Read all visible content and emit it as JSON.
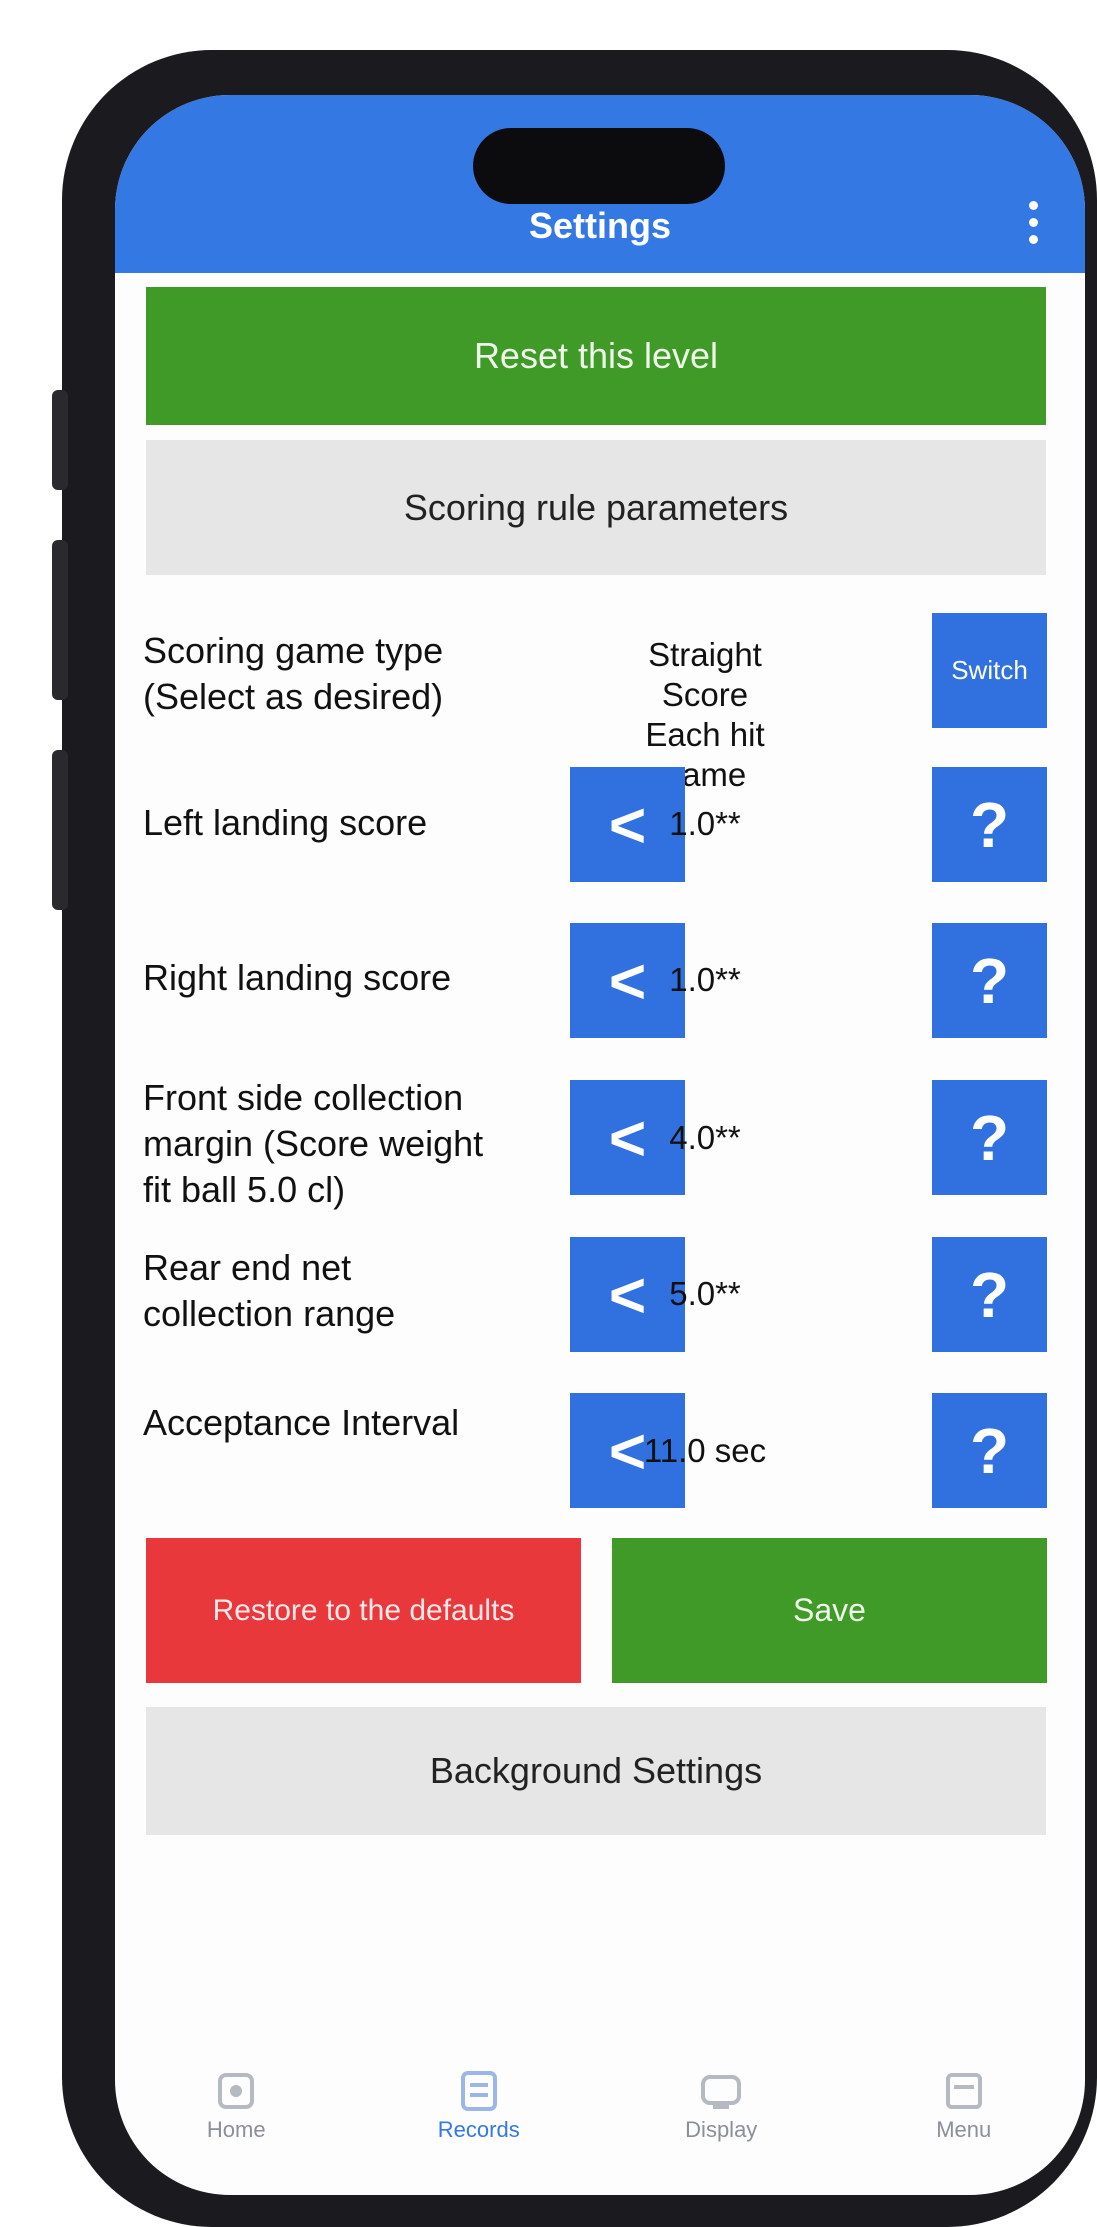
{
  "status": {
    "time": "",
    "indicators": ""
  },
  "appbar": {
    "title": "Settings"
  },
  "top_button": {
    "label": "Reset this level"
  },
  "section_header": {
    "label": "Scoring rule parameters"
  },
  "rows": [
    {
      "label": "Scoring game type (Select as desired)",
      "value": "Straight Score\nEach hit game",
      "action": "Switch",
      "action_type": "switch"
    },
    {
      "label": "Left landing score",
      "value": "1.0**",
      "action": "?",
      "action_type": "help"
    },
    {
      "label": "Right landing score",
      "value": "1.0**",
      "action": "?",
      "action_type": "help"
    },
    {
      "label": "Front side collection margin (Score weight fit ball 5.0 cl)",
      "value": "4.0**",
      "action": "?",
      "action_type": "help"
    },
    {
      "label": "Rear end net collection range",
      "value": "5.0**",
      "action": "?",
      "action_type": "help"
    },
    {
      "label": "Acceptance Interval",
      "value": "11.0 sec",
      "action": "?",
      "action_type": "help"
    }
  ],
  "decrement_label": "<",
  "restore_button": {
    "label": "Restore to the defaults"
  },
  "save_button": {
    "label": "Save"
  },
  "bottom_section": {
    "label": "Background Settings"
  },
  "tabs": [
    {
      "label": "Home",
      "icon": "home-icon",
      "active": false
    },
    {
      "label": "Records",
      "icon": "records-icon",
      "active": true
    },
    {
      "label": "Display",
      "icon": "display-icon",
      "active": false
    },
    {
      "label": "Menu",
      "icon": "menu-icon",
      "active": false
    }
  ],
  "colors": {
    "appbar": "#3478e4",
    "green": "#3f9a27",
    "red": "#e8383c",
    "step_button": "#3070df"
  }
}
